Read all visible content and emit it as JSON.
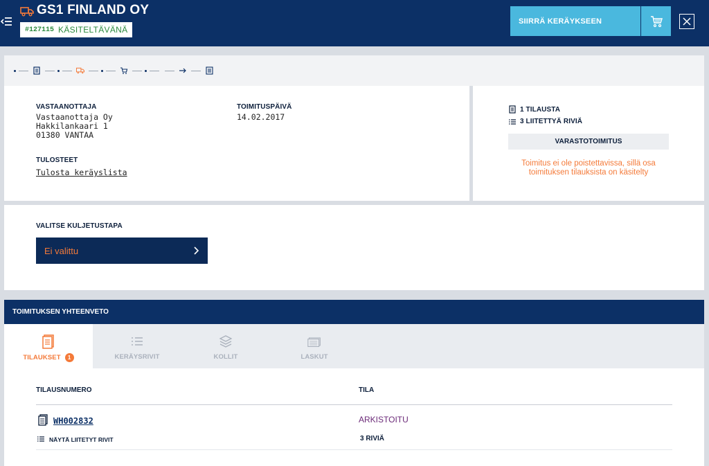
{
  "header": {
    "company": "GS1 FINLAND OY",
    "order_id": "#127115",
    "status": "KÄSITELTÄVÄNÄ",
    "move_button": "SIIRRÄ KERÄYKSEEN",
    "icons": [
      "menu-icon",
      "truck-icon",
      "cart-icon",
      "close-icon"
    ]
  },
  "steps": {
    "icons": [
      "document-icon",
      "truck-icon",
      "cart-icon",
      "arrow-right-icon",
      "invoice-icon"
    ],
    "active_color": "#f47a39"
  },
  "info": {
    "recipient_label": "VASTAANOTTAJA",
    "recipient_name": "Vastaanottaja Oy",
    "recipient_street": "Hakkilankaari 1",
    "recipient_city": "01380 VANTAA",
    "delivery_date_label": "TOIMITUSPÄIVÄ",
    "delivery_date": "14.02.2017",
    "prints_label": "TULOSTEET",
    "print_link": "Tulosta keräyslista"
  },
  "summary": {
    "orders_count": "1 TILAUSTA",
    "rows_count": "3 LIITETTYÄ RIVIÄ",
    "type": "VARASTOTOIMITUS",
    "warning": "Toimitus ei ole poistettavissa, sillä osa toimituksen tilauksista on käsitelty"
  },
  "transport": {
    "label": "VALITSE KULJETUSTAPA",
    "selected": "Ei valittu"
  },
  "overview": {
    "title": "TOIMITUKSEN YHTEENVETO",
    "tabs": [
      {
        "label": "TILAUKSET",
        "badge": "1"
      },
      {
        "label": "KERÄYSRIVIT"
      },
      {
        "label": "KOLLIT"
      },
      {
        "label": "LASKUT"
      }
    ]
  },
  "table": {
    "col_order": "TILAUSNUMERO",
    "col_status": "TILA",
    "rows": [
      {
        "order": "WH002832",
        "status": "ARKISTOITU",
        "sub_link": "NÄYTÄ LIITETYT RIVIT",
        "row_count": "3  RIVIÄ"
      }
    ]
  },
  "colors": {
    "navy": "#0c3066",
    "accent": "#f47a39",
    "button": "#4ab8de",
    "status_green": "#2b8a3e",
    "archived": "#6b2a78"
  }
}
